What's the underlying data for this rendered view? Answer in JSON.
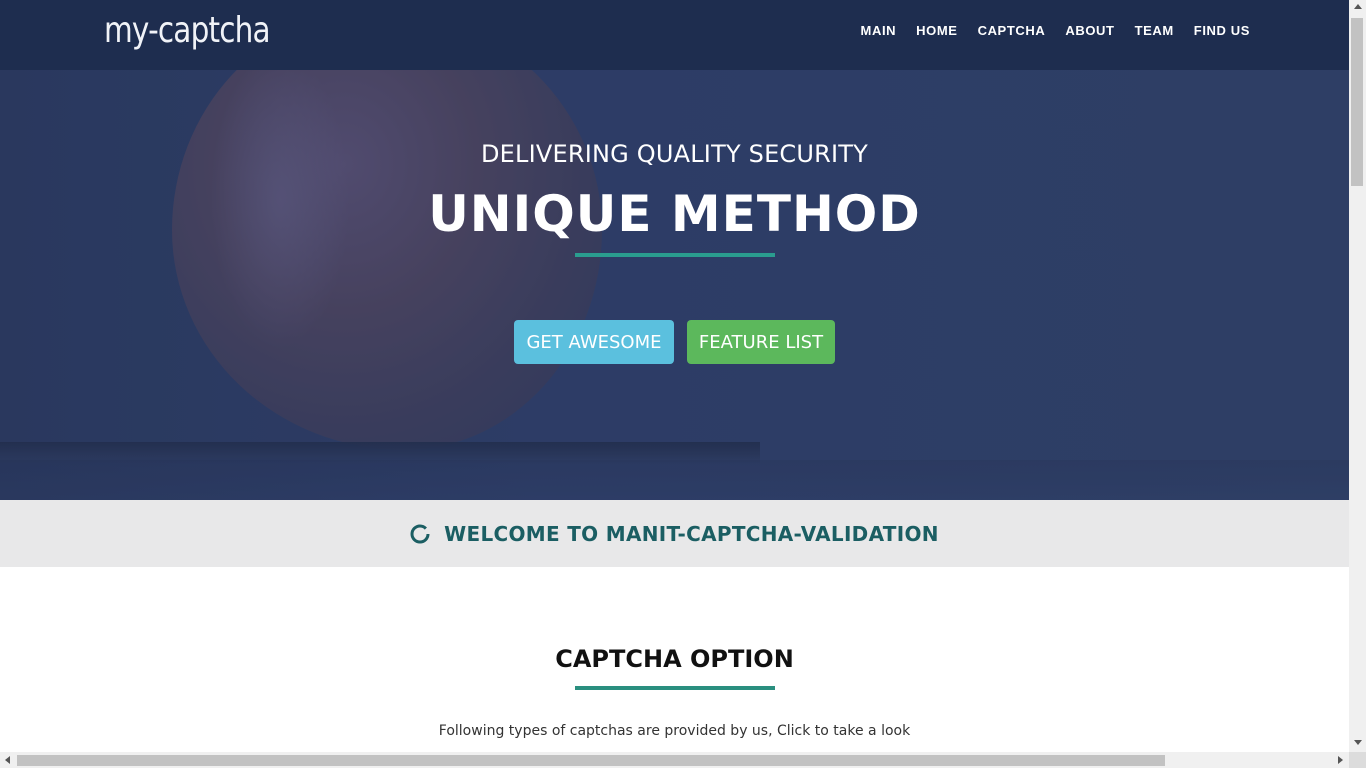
{
  "navbar": {
    "brand": "my-captcha",
    "links": [
      "MAIN",
      "HOME",
      "CAPTCHA",
      "ABOUT",
      "TEAM",
      "FIND US"
    ]
  },
  "hero": {
    "subtitle": "DELIVERING QUALITY SECURITY",
    "title": "UNIQUE METHOD",
    "buttons": {
      "primary": "GET AWESOME",
      "secondary": "FEATURE LIST"
    }
  },
  "welcome": {
    "text": "WELCOME TO MANIT-CAPTCHA-VALIDATION",
    "icon": "spinner-icon"
  },
  "captcha_section": {
    "title": "CAPTCHA OPTION",
    "description": "Following types of captchas are provided by us, Click to take a look"
  },
  "colors": {
    "navbar_bg": "#1e2d4f",
    "accent_teal": "#2a9d8f",
    "welcome_text": "#1b5e63",
    "btn_info": "#5bc0de",
    "btn_success": "#5cb85c"
  }
}
